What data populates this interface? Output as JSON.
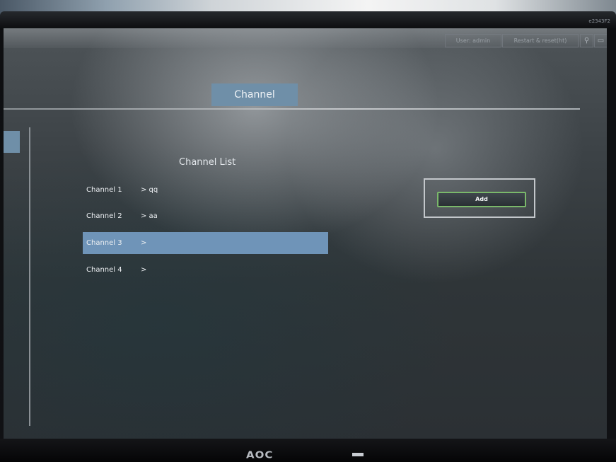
{
  "monitor": {
    "model_label": "e2343F2",
    "brand": "AOC"
  },
  "header": {
    "user_label": "User: admin",
    "logout_label": "Restart & reset(ht)",
    "icons": [
      "help-icon",
      "window-icon"
    ]
  },
  "tabs": {
    "active_label": "Channel"
  },
  "channel_list": {
    "title": "Channel List",
    "rows": [
      {
        "name": "Channel 1",
        "value": "> qq",
        "selected": false
      },
      {
        "name": "Channel 2",
        "value": "> aa",
        "selected": false
      },
      {
        "name": "Channel 3",
        "value": ">",
        "selected": true
      },
      {
        "name": "Channel 4",
        "value": ">",
        "selected": false
      }
    ]
  },
  "actions": {
    "add_label": "Add"
  },
  "colors": {
    "accent": "#6f94b8",
    "button_border": "#7ab86a"
  }
}
